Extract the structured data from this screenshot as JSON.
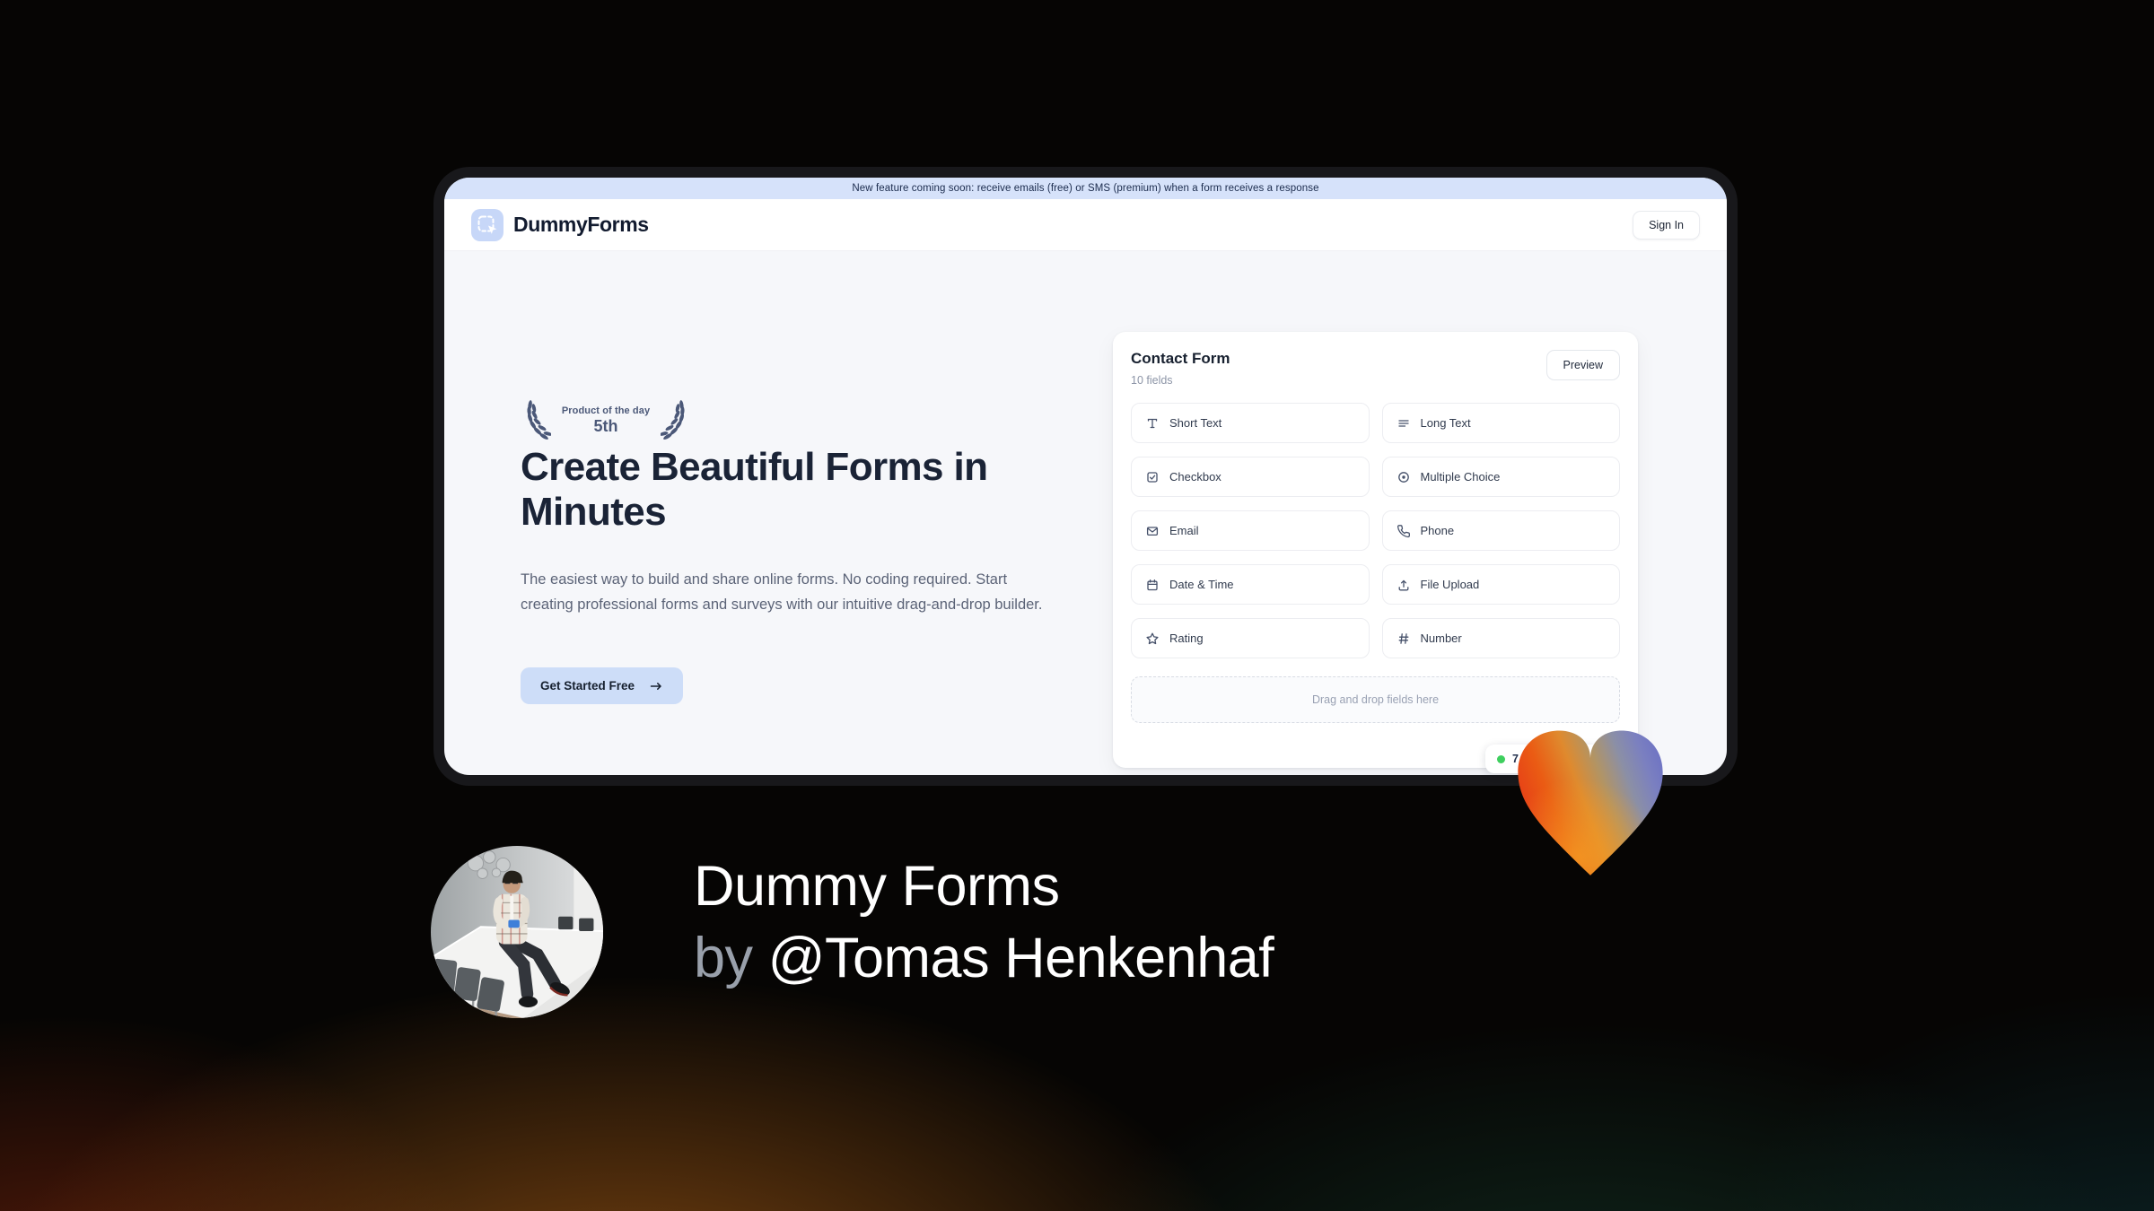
{
  "banner": {
    "text": "New feature coming soon: receive emails (free) or SMS (premium) when a form receives a response"
  },
  "header": {
    "brand": "DummyForms",
    "sign_in_label": "Sign In"
  },
  "hero": {
    "award_line1": "Product of the day",
    "award_line2": "5th",
    "headline": "Create Beautiful Forms in Minutes",
    "description": "The easiest way to build and share online forms. No coding required. Start creating professional forms and surveys with our intuitive drag-and-drop builder.",
    "cta_label": "Get Started Free"
  },
  "form_card": {
    "title": "Contact Form",
    "field_count_label": "10 fields",
    "preview_label": "Preview",
    "fields": [
      {
        "label": "Short Text",
        "icon": "short-text-icon"
      },
      {
        "label": "Long Text",
        "icon": "long-text-icon"
      },
      {
        "label": "Checkbox",
        "icon": "checkbox-icon"
      },
      {
        "label": "Multiple Choice",
        "icon": "multiple-choice-icon"
      },
      {
        "label": "Email",
        "icon": "email-icon"
      },
      {
        "label": "Phone",
        "icon": "phone-icon"
      },
      {
        "label": "Date & Time",
        "icon": "calendar-icon"
      },
      {
        "label": "File Upload",
        "icon": "upload-icon"
      },
      {
        "label": "Rating",
        "icon": "star-icon"
      },
      {
        "label": "Number",
        "icon": "hash-icon"
      }
    ],
    "dropzone_text": "Drag and drop fields here",
    "status_badge_text": "7"
  },
  "footer": {
    "title": "Dummy Forms",
    "byline_prefix": "by",
    "byline_handle": "@Tomas Henkenhaf"
  },
  "colors": {
    "banner_bg": "#d6e2fa",
    "accent_blue": "#cdddf8",
    "logo_blue": "#c7d7f8",
    "ink": "#1a2336",
    "muted": "#5b6377",
    "laurel": "#4b5878",
    "badge_dot_green": "#3ecf5e",
    "heart_red": "#e63b17",
    "heart_orange": "#f0931f",
    "heart_purple": "#6e73c4"
  }
}
